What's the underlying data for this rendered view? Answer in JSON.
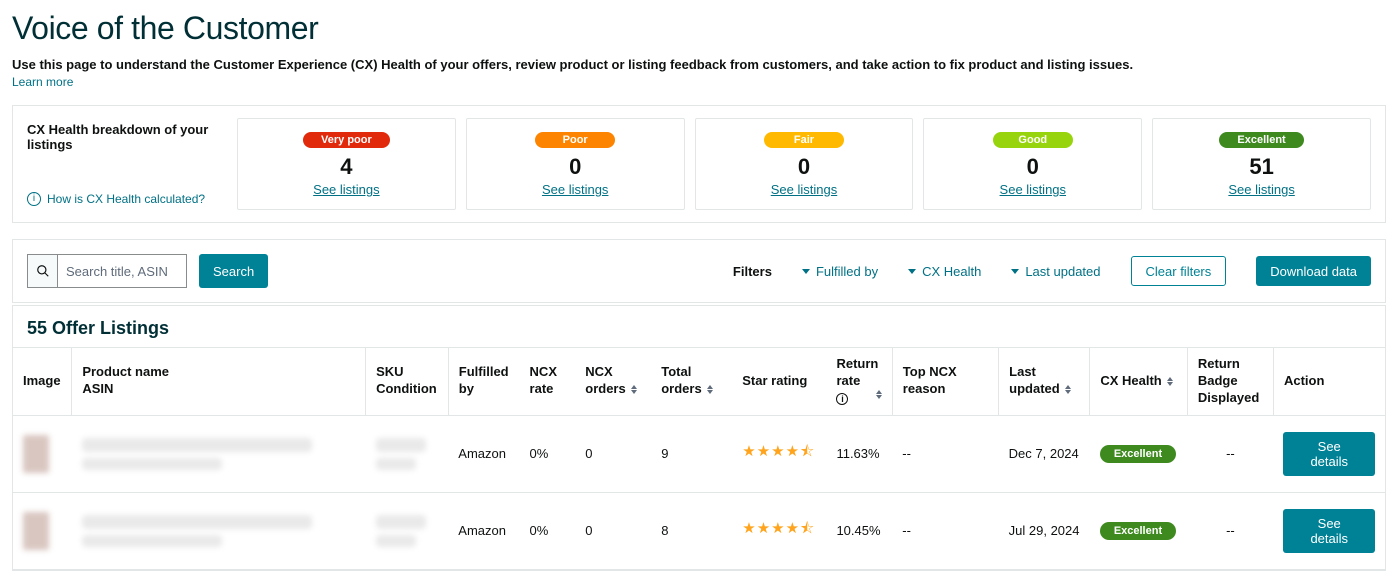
{
  "page_title": "Voice of the Customer",
  "subtitle": "Use this page to understand the Customer Experience (CX) Health of your offers, review product or listing feedback from customers, and take action to fix product and listing issues.",
  "learn_more": "Learn more",
  "breakdown": {
    "title": "CX Health breakdown of your listings",
    "help_text": "How is CX Health calculated?",
    "see_listings_label": "See listings",
    "cards": [
      {
        "label": "Very poor",
        "count": "4",
        "pill_class": "vpoor"
      },
      {
        "label": "Poor",
        "count": "0",
        "pill_class": "poor"
      },
      {
        "label": "Fair",
        "count": "0",
        "pill_class": "fair"
      },
      {
        "label": "Good",
        "count": "0",
        "pill_class": "good"
      },
      {
        "label": "Excellent",
        "count": "51",
        "pill_class": "excellent"
      }
    ]
  },
  "filter_bar": {
    "search_placeholder": "Search title, ASIN",
    "search_button": "Search",
    "filters_label": "Filters",
    "dropdowns": [
      {
        "label": "Fulfilled by"
      },
      {
        "label": "CX Health"
      },
      {
        "label": "Last updated"
      }
    ],
    "clear_filters": "Clear filters",
    "download": "Download data"
  },
  "table": {
    "title": "55 Offer Listings",
    "columns": {
      "image": "Image",
      "product": "Product name\nASIN",
      "sku": "SKU\nCondition",
      "fulfilled": "Fulfilled by",
      "ncx_rate": "NCX rate",
      "ncx_orders": "NCX orders",
      "total_orders": "Total orders",
      "star_rating": "Star rating",
      "return_rate": "Return rate",
      "top_ncx": "Top NCX reason",
      "last_updated": "Last updated",
      "cx_health": "CX Health",
      "return_badge": "Return Badge Displayed",
      "action": "Action"
    },
    "rows": [
      {
        "fulfilled": "Amazon",
        "ncx_rate": "0%",
        "ncx_orders": "0",
        "total_orders": "9",
        "star_value": 4.5,
        "return_rate": "11.63%",
        "top_ncx": "--",
        "last_updated": "Dec 7, 2024",
        "cx_health": "Excellent",
        "return_badge": "--",
        "action": "See details"
      },
      {
        "fulfilled": "Amazon",
        "ncx_rate": "0%",
        "ncx_orders": "0",
        "total_orders": "8",
        "star_value": 4.5,
        "return_rate": "10.45%",
        "top_ncx": "--",
        "last_updated": "Jul 29, 2024",
        "cx_health": "Excellent",
        "return_badge": "--",
        "action": "See details"
      }
    ]
  }
}
